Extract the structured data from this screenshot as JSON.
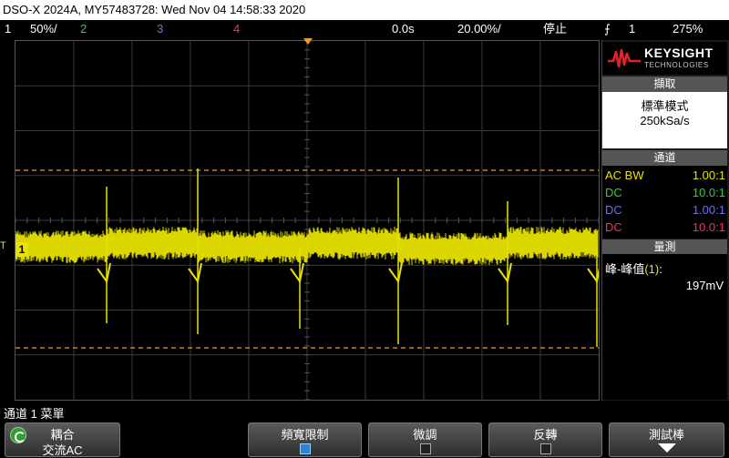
{
  "title": "DSO-X 2024A, MY57483728: Wed Nov 04 14:58:33 2020",
  "status": {
    "ch1_num": "1",
    "ch1_scale": "50%/",
    "ch2_num": "2",
    "ch3_num": "3",
    "ch4_num": "4",
    "time_offset": "0.0s",
    "time_scale": "20.00%/",
    "run_state": "停止",
    "trig_src": "1",
    "trig_level": "275%"
  },
  "ch1_marker": {
    "t": "T",
    "box": "1"
  },
  "panel": {
    "brand": "KEYSIGHT",
    "brand_sub": "TECHNOLOGIES",
    "acq_title": "擷取",
    "acq_mode": "標準模式",
    "acq_rate": "250kSa/s",
    "chan_title": "通道",
    "channels": [
      {
        "coupling": "AC BW",
        "ratio": "1.00:1",
        "color": "#e8e200"
      },
      {
        "coupling": "DC",
        "ratio": "10.0:1",
        "color": "#33d233"
      },
      {
        "coupling": "DC",
        "ratio": "1.00:1",
        "color": "#6e6ef0"
      },
      {
        "coupling": "DC",
        "ratio": "10.0:1",
        "color": "#e8356b"
      }
    ],
    "meas_title": "量測",
    "meas_label": "峰-峰值",
    "meas_label_num": "(1)",
    "meas_label_tail": ":",
    "meas_value": "197mV"
  },
  "menu_title": "通道 1 菜單",
  "softkeys": {
    "coupling_label": "耦合",
    "coupling_value": "交流AC",
    "bw_limit": "頻寬限制",
    "bw_limit_on": true,
    "fine": "微調",
    "invert": "反轉",
    "probe": "測試棒"
  },
  "colors": {
    "trace": "#e8e200",
    "cursor": "#f39a2b",
    "grid": "#3c3c3c",
    "accent": "#2a84d6"
  },
  "icons": [
    "knob-icon",
    "trigger-marker-icon",
    "ground-icon",
    "down-arrow-icon",
    "keysight-wave-icon"
  ]
}
